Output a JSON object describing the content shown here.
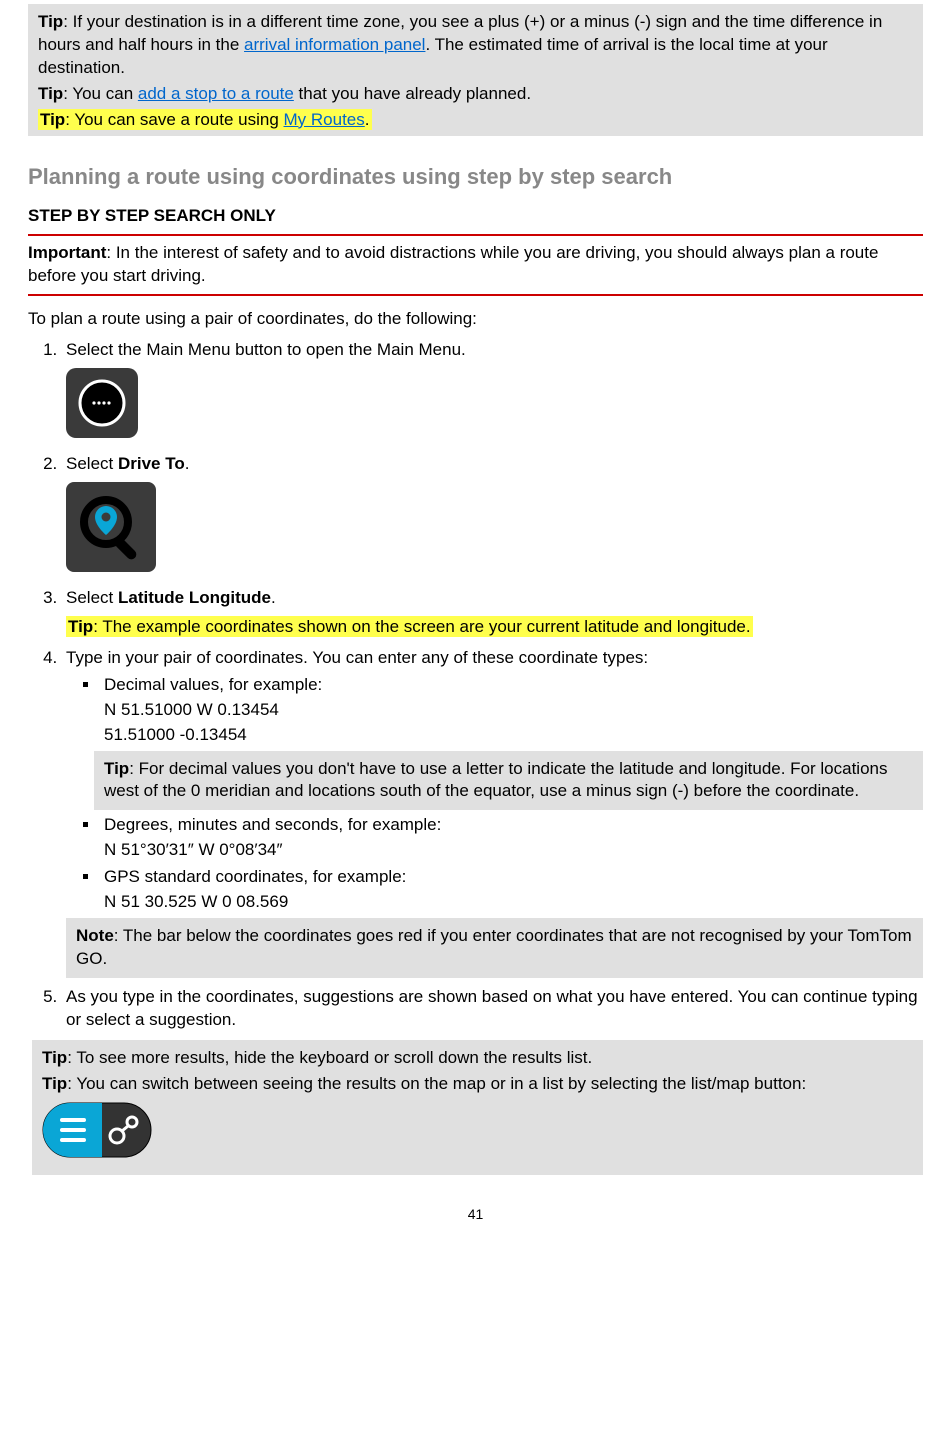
{
  "top_tips": {
    "tip1": {
      "label": "Tip",
      "text_before": ": If your destination is in a different time zone, you see a plus (+) or a minus (-) sign and the time difference in hours and half hours in the ",
      "link": "arrival information panel",
      "text_after": ". The estimated time of arrival is the local time at your destination."
    },
    "tip2": {
      "label": "Tip",
      "text_before": ": You can ",
      "link": "add a stop to a route",
      "text_after": " that you have already planned."
    },
    "tip3": {
      "label": "Tip",
      "text_before": ": You can save a route using ",
      "link": "My Routes",
      "text_after": "."
    }
  },
  "section_title": "Planning a route using coordinates using step by step search",
  "subhead": "STEP BY STEP SEARCH ONLY",
  "important": {
    "label": "Important",
    "text": ": In the interest of safety and to avoid distractions while you are driving, you should always plan a route before you start driving."
  },
  "intro": "To plan a route using a pair of coordinates, do the following:",
  "step1": {
    "text": "Select the Main Menu button to open the Main Menu."
  },
  "step2": {
    "prefix": "Select ",
    "bold": "Drive To",
    "suffix": "."
  },
  "step3": {
    "prefix": "Select ",
    "bold": "Latitude Longitude",
    "suffix": ".",
    "tip_label": "Tip",
    "tip_text": ": The example coordinates shown on the screen are your current latitude and longitude."
  },
  "step4": {
    "intro": "Type in your pair of coordinates. You can enter any of these coordinate types:",
    "bullet1": "Decimal values, for example:",
    "ex1a": "N 51.51000    W 0.13454",
    "ex1b": "51.51000    -0.13454",
    "tip_label": "Tip",
    "tip_text": ": For decimal values you don't have to use a letter to indicate the latitude and longitude. For locations west of the 0 meridian and locations south of the equator, use a minus sign (-) before the coordinate.",
    "bullet2": "Degrees, minutes and seconds, for example:",
    "ex2": "N 51°30′31″    W 0°08′34″",
    "bullet3": "GPS standard coordinates, for example:",
    "ex3": "N 51 30.525    W 0 08.569",
    "note_label": "Note",
    "note_text": ": The bar below the coordinates goes red if you enter coordinates that are not recognised by your TomTom GO."
  },
  "step5": {
    "text": "As you type in the coordinates, suggestions are shown based on what you have entered. You can continue typing or select a suggestion.",
    "tip1_label": "Tip",
    "tip1_text": ": To see more results, hide the keyboard or scroll down the results list.",
    "tip2_label": "Tip",
    "tip2_text": ": You can switch between seeing the results on the map or in a list by selecting the list/map button:"
  },
  "page_number": "41"
}
